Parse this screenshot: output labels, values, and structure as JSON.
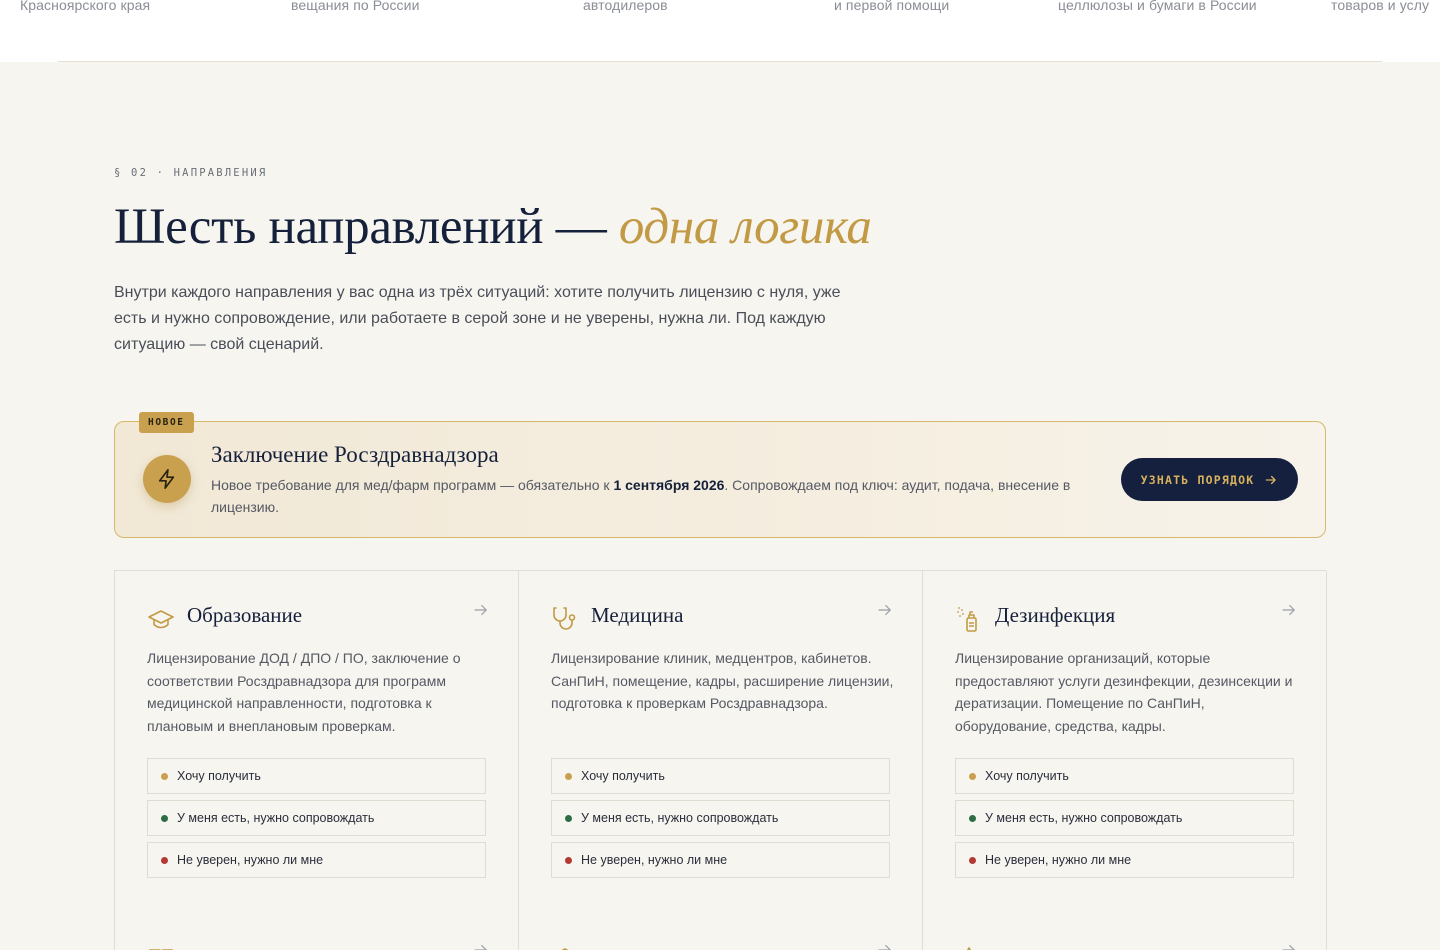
{
  "strip": {
    "items": [
      "Красноярского края",
      "вещания по России",
      "автодилеров",
      "и первой помощи",
      "целлюлозы и бумаги в России",
      "товаров и услу"
    ]
  },
  "section": {
    "eyebrow": "§ 02 · НАПРАВЛЕНИЯ",
    "title_main": "Шесть направлений — ",
    "title_accent": "одна логика",
    "lead": "Внутри каждого направления у вас одна из трёх ситуаций: хотите получить лицензию с нуля, уже есть и нужно сопровождение, или работаете в серой зоне и не уверены, нужна ли. Под каждую ситуацию — свой сценарий."
  },
  "promo": {
    "badge": "НОВОЕ",
    "icon": "lightning-icon",
    "title": "Заключение Росздравнадзора",
    "text_before": "Новое требование для мед/фарм программ — обязательно к ",
    "text_bold": "1 сентября 2026",
    "text_after": ". Сопровождаем под ключ: аудит, подача, внесение в лицензию.",
    "cta_label": "УЗНАТЬ ПОРЯДОК"
  },
  "options": {
    "get": "Хочу получить",
    "have": "У меня есть, нужно сопровождать",
    "unsure": "Не уверен, нужно ли мне"
  },
  "cards": [
    {
      "title": "Образование",
      "icon": "graduation-cap-icon",
      "desc": "Лицензирование ДОД / ДПО / ПО, заключение о соответствии Росздравнадзора для программ медицинской направленности, подготовка к плановым и внеплановым проверкам."
    },
    {
      "title": "Медицина",
      "icon": "stethoscope-icon",
      "desc": "Лицензирование клиник, медцентров, кабинетов. СанПиН, помещение, кадры, расширение лицензии, подготовка к проверкам Росздравнадзора."
    },
    {
      "title": "Дезинфекция",
      "icon": "spray-bottle-icon",
      "desc": "Лицензирование организаций, которые предоставляют услуги дезинфекции, дезинсекции и дератизации. Помещение по СанПиН, оборудование, средства, кадры."
    }
  ],
  "colors": {
    "navy": "#15203a",
    "gold": "#c29a45",
    "dot_get": "#c9a04e",
    "dot_have": "#2f6b45",
    "dot_unsure": "#b23a32"
  }
}
